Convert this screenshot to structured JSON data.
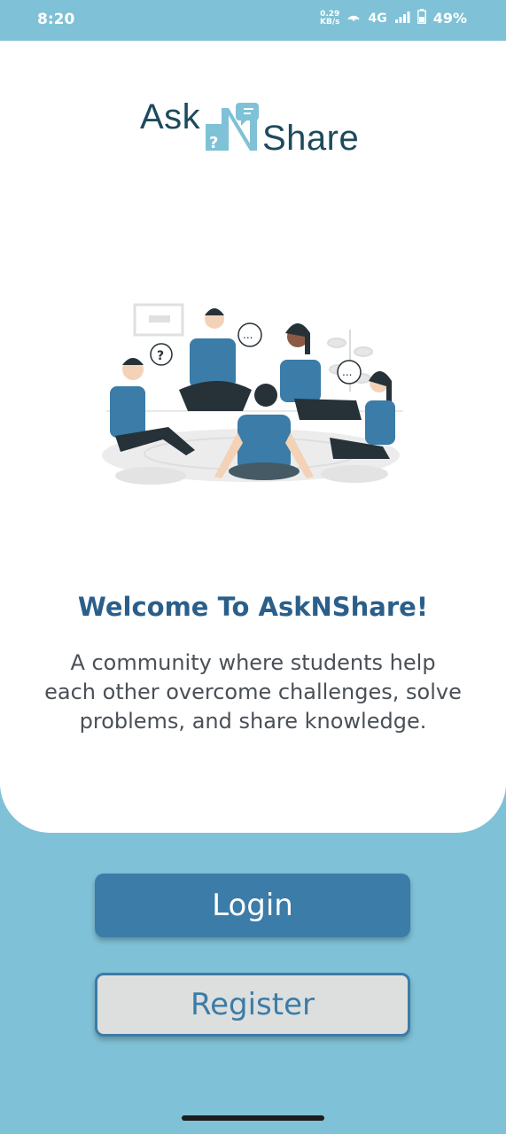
{
  "status_bar": {
    "time": "8:20",
    "net_speed_value": "0.29",
    "net_speed_unit": "KB/s",
    "network_type": "4G",
    "battery": "49%",
    "icons": [
      "hotspot-icon",
      "signal-icon",
      "battery-icon"
    ]
  },
  "logo": {
    "part1": "Ask",
    "part2": "N",
    "part3": "Share",
    "question_mark": "?"
  },
  "illustration": {
    "icon": "students-discussion-illustration",
    "bubble_question": "?",
    "bubble_dots": "..."
  },
  "welcome": {
    "title": "Welcome To AskNShare!",
    "line1": "A community where students help",
    "line2": "each other overcome challenges, solve",
    "line3": "problems, and share knowledge."
  },
  "buttons": {
    "login": "Login",
    "register": "Register"
  },
  "colors": {
    "background": "#7fc1d6",
    "primary": "#3b7ca8",
    "title": "#2b5f8a",
    "logo_text": "#1d4a5c"
  }
}
